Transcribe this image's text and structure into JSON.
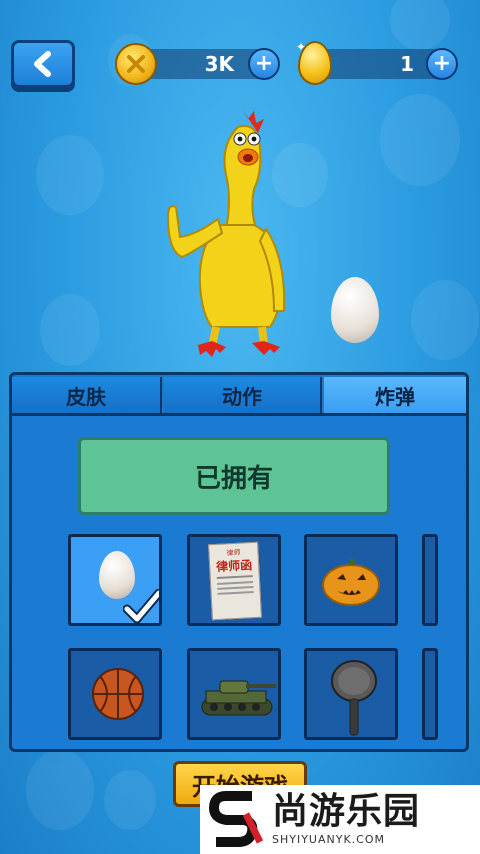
{
  "header": {
    "back_icon": "chevron-left-icon",
    "coins": {
      "value": "3K",
      "icon": "gold-coin-icon",
      "plus_label": "+"
    },
    "eggs": {
      "value": "1",
      "icon": "golden-egg-icon",
      "plus_label": "+"
    }
  },
  "preview": {
    "character": "rubber-chicken",
    "bomb_item": "egg"
  },
  "tabs": [
    {
      "label": "皮肤",
      "active": false
    },
    {
      "label": "动作",
      "active": false
    },
    {
      "label": "炸弹",
      "active": true
    }
  ],
  "owned_button": {
    "label": "已拥有"
  },
  "items": [
    {
      "name": "egg",
      "selected": true
    },
    {
      "name": "lawyer-letter",
      "selected": false
    },
    {
      "name": "pumpkin",
      "selected": false
    },
    {
      "name": "basketball",
      "selected": false
    },
    {
      "name": "tank",
      "selected": false
    },
    {
      "name": "frying-pan",
      "selected": false
    }
  ],
  "paper_text": {
    "top": "律师",
    "mid": "律师函"
  },
  "start_button": {
    "label": "开始游戏"
  },
  "watermark": {
    "title": "尚游乐园",
    "subtitle": "SHYIYUANYK.COM"
  },
  "colors": {
    "background": "#2a9ae0",
    "panel": "#1b7bd3",
    "owned": "#5fc495",
    "start": "#ffd64a"
  }
}
